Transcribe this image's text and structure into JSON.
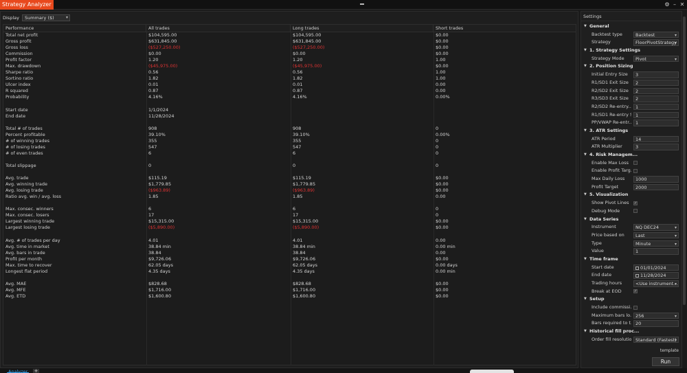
{
  "window": {
    "title": "Strategy Analyzer",
    "controls": {
      "settings": "⚙",
      "minimize": "–",
      "close": "✕"
    }
  },
  "display": {
    "label": "Display",
    "selected": "Summary ($)"
  },
  "performance": {
    "columns": [
      "Performance",
      "All trades",
      "Long trades",
      "Short trades"
    ],
    "rows": [
      {
        "label": "Total net profit",
        "all": "$104,595.00",
        "long": "$104,595.00",
        "short": "$0.00"
      },
      {
        "label": "Gross profit",
        "all": "$631,845.00",
        "long": "$631,845.00",
        "short": "$0.00"
      },
      {
        "label": "Gross loss",
        "all": "($527,250.00)",
        "long": "($527,250.00)",
        "short": "$0.00",
        "neg": true
      },
      {
        "label": "Commission",
        "all": "$0.00",
        "long": "$0.00",
        "short": "$0.00"
      },
      {
        "label": "Profit factor",
        "all": "1.20",
        "long": "1.20",
        "short": "1.00"
      },
      {
        "label": "Max. drawdown",
        "all": "($45,975.00)",
        "long": "($45,975.00)",
        "short": "$0.00",
        "neg": true
      },
      {
        "label": "Sharpe ratio",
        "all": "0.56",
        "long": "0.56",
        "short": "1.00"
      },
      {
        "label": "Sortino ratio",
        "all": "1.82",
        "long": "1.82",
        "short": "1.00"
      },
      {
        "label": "Ulcer index",
        "all": "0.01",
        "long": "0.01",
        "short": "0.00"
      },
      {
        "label": "R squared",
        "all": "0.87",
        "long": "0.87",
        "short": "0.00"
      },
      {
        "label": "Probability",
        "all": "4.16%",
        "long": "4.16%",
        "short": "0.00%"
      },
      {
        "label": "",
        "all": "",
        "long": "",
        "short": ""
      },
      {
        "label": "Start date",
        "all": "1/1/2024",
        "long": "",
        "short": ""
      },
      {
        "label": "End date",
        "all": "11/28/2024",
        "long": "",
        "short": ""
      },
      {
        "label": "",
        "all": "",
        "long": "",
        "short": ""
      },
      {
        "label": "Total # of trades",
        "all": "908",
        "long": "908",
        "short": "0"
      },
      {
        "label": "Percent profitable",
        "all": "39.10%",
        "long": "39.10%",
        "short": "0.00%"
      },
      {
        "label": "# of winning trades",
        "all": "355",
        "long": "355",
        "short": "0"
      },
      {
        "label": "# of losing trades",
        "all": "547",
        "long": "547",
        "short": "0"
      },
      {
        "label": "# of even trades",
        "all": "6",
        "long": "6",
        "short": "0"
      },
      {
        "label": "",
        "all": "",
        "long": "",
        "short": ""
      },
      {
        "label": "Total slippage",
        "all": "0",
        "long": "0",
        "short": "0"
      },
      {
        "label": "",
        "all": "",
        "long": "",
        "short": ""
      },
      {
        "label": "Avg. trade",
        "all": "$115.19",
        "long": "$115.19",
        "short": "$0.00"
      },
      {
        "label": "Avg. winning trade",
        "all": "$1,779.85",
        "long": "$1,779.85",
        "short": "$0.00"
      },
      {
        "label": "Avg. losing trade",
        "all": "($963.89)",
        "long": "($963.89)",
        "short": "$0.00",
        "neg": true
      },
      {
        "label": "Ratio avg. win / avg. loss",
        "all": "1.85",
        "long": "1.85",
        "short": "0.00"
      },
      {
        "label": "",
        "all": "",
        "long": "",
        "short": ""
      },
      {
        "label": "Max. consec. winners",
        "all": "6",
        "long": "6",
        "short": "0"
      },
      {
        "label": "Max. consec. losers",
        "all": "17",
        "long": "17",
        "short": "0"
      },
      {
        "label": "Largest winning trade",
        "all": "$15,315.00",
        "long": "$15,315.00",
        "short": "$0.00"
      },
      {
        "label": "Largest losing trade",
        "all": "($5,890.00)",
        "long": "($5,890.00)",
        "short": "$0.00",
        "neg": true
      },
      {
        "label": "",
        "all": "",
        "long": "",
        "short": ""
      },
      {
        "label": "Avg. # of trades per day",
        "all": "4.01",
        "long": "4.01",
        "short": "0.00"
      },
      {
        "label": "Avg. time in market",
        "all": "38.84 min",
        "long": "38.84 min",
        "short": "0.00 min"
      },
      {
        "label": "Avg. bars in trade",
        "all": "38.84",
        "long": "38.84",
        "short": "0.00"
      },
      {
        "label": "Profit per month",
        "all": "$9,726.06",
        "long": "$9,726.06",
        "short": "$0.00"
      },
      {
        "label": "Max. time to recover",
        "all": "62.05 days",
        "long": "62.05 days",
        "short": "0.00 days"
      },
      {
        "label": "Longest flat period",
        "all": "4.35 days",
        "long": "4.35 days",
        "short": "0.00 min"
      },
      {
        "label": "",
        "all": "",
        "long": "",
        "short": ""
      },
      {
        "label": "Avg. MAE",
        "all": "$828.68",
        "long": "$828.68",
        "short": "$0.00"
      },
      {
        "label": "Avg. MFE",
        "all": "$1,716.00",
        "long": "$1,716.00",
        "short": "$0.00"
      },
      {
        "label": "Avg. ETD",
        "all": "$1,600.80",
        "long": "$1,600.80",
        "short": "$0.00"
      }
    ]
  },
  "settings": {
    "title": "Settings",
    "items": [
      {
        "type": "section",
        "label": "General"
      },
      {
        "type": "select",
        "label": "Backtest type",
        "value": "Backtest"
      },
      {
        "type": "select",
        "label": "Strategy",
        "value": "FloorPivotStrategy"
      },
      {
        "type": "section",
        "label": "1. Strategy Settings"
      },
      {
        "type": "select",
        "label": "Strategy Mode",
        "value": "Pivot"
      },
      {
        "type": "section",
        "label": "2. Position Sizing"
      },
      {
        "type": "input",
        "label": "Initial Entry Size",
        "value": "3"
      },
      {
        "type": "input",
        "label": "R1/SD1 Exit Size",
        "value": "2"
      },
      {
        "type": "input",
        "label": "R2/SD2 Exit Size",
        "value": "2"
      },
      {
        "type": "input",
        "label": "R3/SD3 Exit Size",
        "value": "2"
      },
      {
        "type": "input",
        "label": "R2/SD2 Re-entry...",
        "value": "1"
      },
      {
        "type": "input",
        "label": "R1/SD1 Re-entry Si...",
        "value": "1"
      },
      {
        "type": "input",
        "label": "PP/VWAP Re-entr...",
        "value": "1"
      },
      {
        "type": "section",
        "label": "3. ATR Settings"
      },
      {
        "type": "input",
        "label": "ATR Period",
        "value": "14"
      },
      {
        "type": "input",
        "label": "ATR Multiplier",
        "value": "3"
      },
      {
        "type": "section",
        "label": "4. Risk Managem..."
      },
      {
        "type": "check",
        "label": "Enable Max Loss",
        "checked": false
      },
      {
        "type": "check",
        "label": "Enable Profit Targ...",
        "checked": false
      },
      {
        "type": "input",
        "label": "Max Daily Loss",
        "value": "1000"
      },
      {
        "type": "input",
        "label": "Profit Target",
        "value": "2000"
      },
      {
        "type": "section",
        "label": "5. Visualization"
      },
      {
        "type": "check",
        "label": "Show Pivot Lines",
        "checked": true
      },
      {
        "type": "check",
        "label": "Debug Mode",
        "checked": false
      },
      {
        "type": "section",
        "label": "Data Series"
      },
      {
        "type": "select",
        "label": "Instrument",
        "value": "NQ DEC24"
      },
      {
        "type": "select",
        "label": "Price based on",
        "value": "Last"
      },
      {
        "type": "select",
        "label": "Type",
        "value": "Minute"
      },
      {
        "type": "input",
        "label": "Value",
        "value": "1"
      },
      {
        "type": "section",
        "label": "Time frame"
      },
      {
        "type": "date",
        "label": "Start date",
        "value": "01/01/2024"
      },
      {
        "type": "date",
        "label": "End date",
        "value": "11/28/2024"
      },
      {
        "type": "select",
        "label": "Trading hours",
        "value": "<Use instrument..."
      },
      {
        "type": "check",
        "label": "Break at EOD",
        "checked": true
      },
      {
        "type": "section",
        "label": "Setup"
      },
      {
        "type": "check",
        "label": "Include commissi...",
        "checked": false
      },
      {
        "type": "select",
        "label": "Maximum bars lo...",
        "value": "256"
      },
      {
        "type": "input",
        "label": "Bars required to t...",
        "value": "20"
      },
      {
        "type": "section",
        "label": "Historical fill proc..."
      },
      {
        "type": "select",
        "label": "Order fill resolution",
        "value": "Standard (Fastest)"
      }
    ],
    "template_link": "template",
    "run_label": "Run"
  },
  "tabs": [
    {
      "label": "Analyzer",
      "active": true
    },
    {
      "label": "+"
    }
  ],
  "colors": {
    "accent": "#e8491d",
    "negative": "#e03333",
    "tab_active": "#3aa0e8",
    "background": "#1b1b1b"
  }
}
